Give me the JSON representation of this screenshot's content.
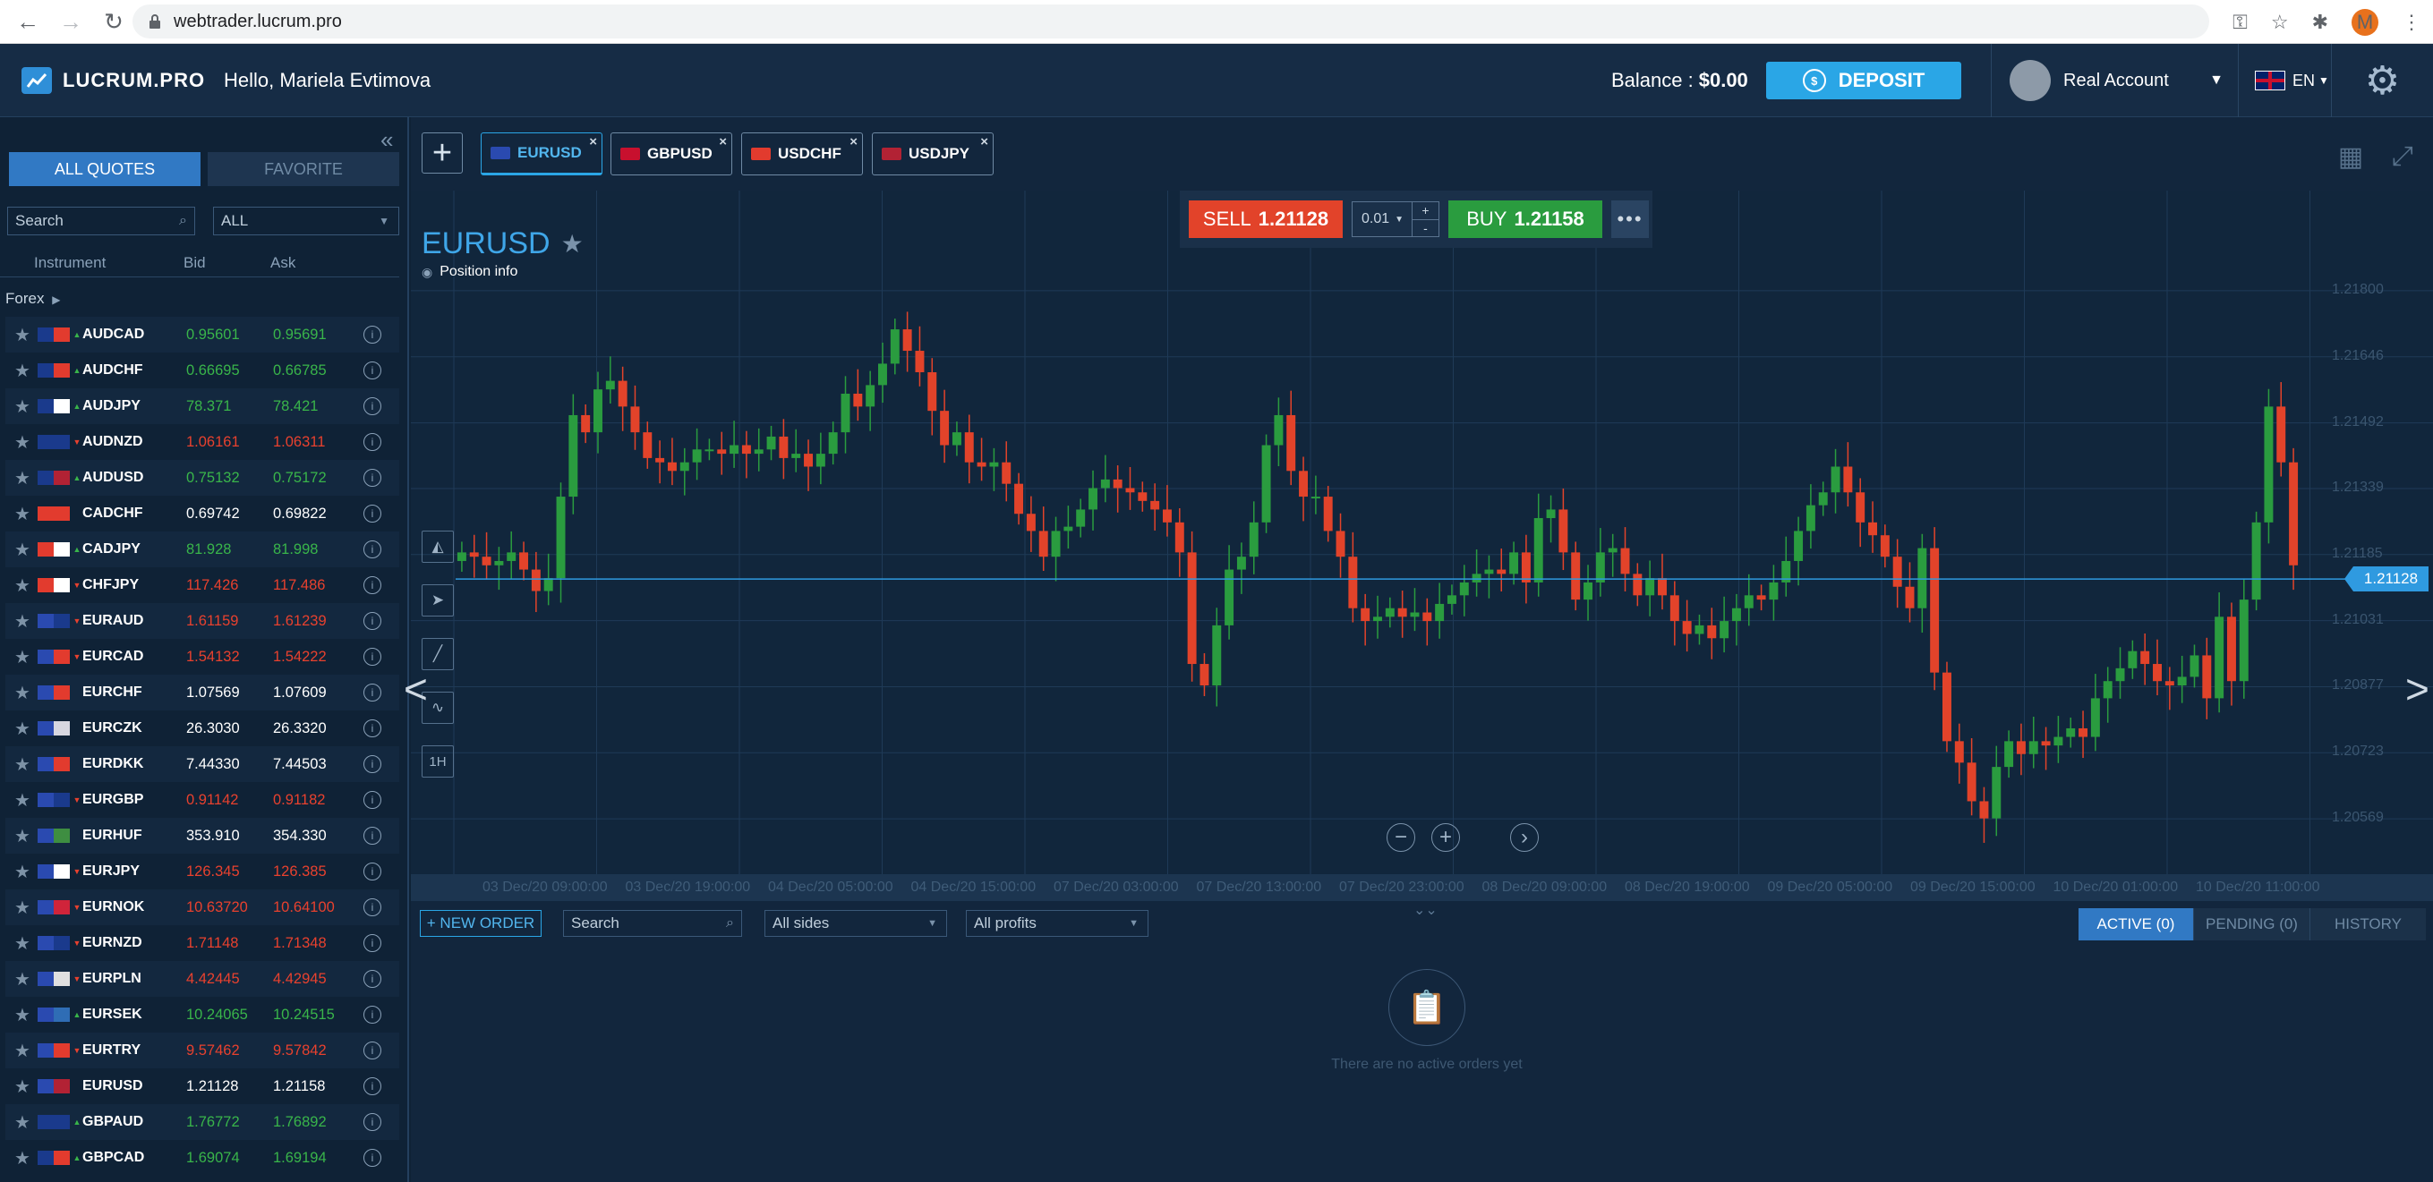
{
  "browser": {
    "url": "webtrader.lucrum.pro",
    "profile_initial": "M"
  },
  "header": {
    "logo": "LUCRUM.PRO",
    "greeting": "Hello, Mariela Evtimova",
    "balance_label": "Balance :",
    "balance_value": "$0.00",
    "deposit_label": "DEPOSIT",
    "account_label": "Real Account",
    "language": "EN"
  },
  "sidebar": {
    "tab_all": "ALL QUOTES",
    "tab_favorite": "FAVORITE",
    "search_placeholder": "Search",
    "filter_value": "ALL",
    "col_instrument": "Instrument",
    "col_bid": "Bid",
    "col_ask": "Ask",
    "group": "Forex",
    "quotes": [
      {
        "sym": "AUDCAD",
        "bid": "0.95601",
        "ask": "0.95691",
        "dir": "up",
        "color": "green",
        "f1": "#1a3a8c",
        "f2": "#e23b2e"
      },
      {
        "sym": "AUDCHF",
        "bid": "0.66695",
        "ask": "0.66785",
        "dir": "up",
        "color": "green",
        "f1": "#1a3a8c",
        "f2": "#e23b2e"
      },
      {
        "sym": "AUDJPY",
        "bid": "78.371",
        "ask": "78.421",
        "dir": "up",
        "color": "green",
        "f1": "#1a3a8c",
        "f2": "#ffffff"
      },
      {
        "sym": "AUDNZD",
        "bid": "1.06161",
        "ask": "1.06311",
        "dir": "down",
        "color": "red",
        "f1": "#1a3a8c",
        "f2": "#1a3a8c"
      },
      {
        "sym": "AUDUSD",
        "bid": "0.75132",
        "ask": "0.75172",
        "dir": "up",
        "color": "green",
        "f1": "#1a3a8c",
        "f2": "#b22234"
      },
      {
        "sym": "CADCHF",
        "bid": "0.69742",
        "ask": "0.69822",
        "dir": "none",
        "color": "white",
        "f1": "#e23b2e",
        "f2": "#e23b2e"
      },
      {
        "sym": "CADJPY",
        "bid": "81.928",
        "ask": "81.998",
        "dir": "up",
        "color": "green",
        "f1": "#e23b2e",
        "f2": "#ffffff"
      },
      {
        "sym": "CHFJPY",
        "bid": "117.426",
        "ask": "117.486",
        "dir": "down",
        "color": "red",
        "f1": "#e23b2e",
        "f2": "#ffffff"
      },
      {
        "sym": "EURAUD",
        "bid": "1.61159",
        "ask": "1.61239",
        "dir": "down",
        "color": "red",
        "f1": "#2a4ab0",
        "f2": "#1a3a8c"
      },
      {
        "sym": "EURCAD",
        "bid": "1.54132",
        "ask": "1.54222",
        "dir": "down",
        "color": "red",
        "f1": "#2a4ab0",
        "f2": "#e23b2e"
      },
      {
        "sym": "EURCHF",
        "bid": "1.07569",
        "ask": "1.07609",
        "dir": "none",
        "color": "white",
        "f1": "#2a4ab0",
        "f2": "#e23b2e"
      },
      {
        "sym": "EURCZK",
        "bid": "26.3030",
        "ask": "26.3320",
        "dir": "none",
        "color": "white",
        "f1": "#2a4ab0",
        "f2": "#d7d7e0"
      },
      {
        "sym": "EURDKK",
        "bid": "7.44330",
        "ask": "7.44503",
        "dir": "none",
        "color": "white",
        "f1": "#2a4ab0",
        "f2": "#e23b2e"
      },
      {
        "sym": "EURGBP",
        "bid": "0.91142",
        "ask": "0.91182",
        "dir": "down",
        "color": "red",
        "f1": "#2a4ab0",
        "f2": "#1a3a8c"
      },
      {
        "sym": "EURHUF",
        "bid": "353.910",
        "ask": "354.330",
        "dir": "none",
        "color": "white",
        "f1": "#2a4ab0",
        "f2": "#3e8e41"
      },
      {
        "sym": "EURJPY",
        "bid": "126.345",
        "ask": "126.385",
        "dir": "down",
        "color": "red",
        "f1": "#2a4ab0",
        "f2": "#ffffff"
      },
      {
        "sym": "EURNOK",
        "bid": "10.63720",
        "ask": "10.64100",
        "dir": "down",
        "color": "red",
        "f1": "#2a4ab0",
        "f2": "#d0243a"
      },
      {
        "sym": "EURNZD",
        "bid": "1.71148",
        "ask": "1.71348",
        "dir": "down",
        "color": "red",
        "f1": "#2a4ab0",
        "f2": "#1a3a8c"
      },
      {
        "sym": "EURPLN",
        "bid": "4.42445",
        "ask": "4.42945",
        "dir": "down",
        "color": "red",
        "f1": "#2a4ab0",
        "f2": "#e0e0e0"
      },
      {
        "sym": "EURSEK",
        "bid": "10.24065",
        "ask": "10.24515",
        "dir": "up",
        "color": "green",
        "f1": "#2a4ab0",
        "f2": "#2f6db5"
      },
      {
        "sym": "EURTRY",
        "bid": "9.57462",
        "ask": "9.57842",
        "dir": "down",
        "color": "red",
        "f1": "#2a4ab0",
        "f2": "#e23b2e"
      },
      {
        "sym": "EURUSD",
        "bid": "1.21128",
        "ask": "1.21158",
        "dir": "none",
        "color": "white",
        "f1": "#2a4ab0",
        "f2": "#b22234"
      },
      {
        "sym": "GBPAUD",
        "bid": "1.76772",
        "ask": "1.76892",
        "dir": "up",
        "color": "green",
        "f1": "#1a3a8c",
        "f2": "#1a3a8c"
      },
      {
        "sym": "GBPCAD",
        "bid": "1.69074",
        "ask": "1.69194",
        "dir": "up",
        "color": "green",
        "f1": "#1a3a8c",
        "f2": "#e23b2e"
      }
    ]
  },
  "tabs": [
    {
      "label": "EURUSD",
      "active": true,
      "flag": "#2a4ab0"
    },
    {
      "label": "GBPUSD",
      "active": false,
      "flag": "#c8102e"
    },
    {
      "label": "USDCHF",
      "active": false,
      "flag": "#e23b2e"
    },
    {
      "label": "USDJPY",
      "active": false,
      "flag": "#b22234"
    }
  ],
  "trade": {
    "symbol": "EURUSD",
    "position_info": "Position info",
    "sell_label": "SELL",
    "sell_price": "1.21128",
    "lot": "0.01",
    "buy_label": "BUY",
    "buy_price": "1.21158",
    "current_price_label": "1.21128"
  },
  "colors": {
    "up": "#2a9c3f",
    "down": "#e2432a",
    "price_line": "#2f9ae0"
  },
  "chart_data": {
    "type": "candlestick",
    "title": "EURUSD",
    "current_price": 1.21128,
    "ylim": [
      1.2049,
      1.2195
    ],
    "y_ticks": [
      "1.21800",
      "1.21646",
      "1.21492",
      "1.21339",
      "1.21185",
      "1.21031",
      "1.20877",
      "1.20723",
      "1.20569"
    ],
    "x_ticks": [
      "03 Dec/20 09:00:00",
      "03 Dec/20 19:00:00",
      "04 Dec/20 05:00:00",
      "04 Dec/20 15:00:00",
      "07 Dec/20 03:00:00",
      "07 Dec/20 13:00:00",
      "07 Dec/20 23:00:00",
      "08 Dec/20 09:00:00",
      "08 Dec/20 19:00:00",
      "09 Dec/20 05:00:00",
      "09 Dec/20 15:00:00",
      "10 Dec/20 01:00:00",
      "10 Dec/20 11:00:00"
    ],
    "closes": [
      1.2119,
      1.2118,
      1.2116,
      1.2117,
      1.2119,
      1.2115,
      1.211,
      1.2113,
      1.2132,
      1.2151,
      1.2147,
      1.2157,
      1.2159,
      1.2153,
      1.2147,
      1.2141,
      1.214,
      1.2138,
      1.214,
      1.2143,
      1.2143,
      1.2142,
      1.2144,
      1.2142,
      1.2143,
      1.2146,
      1.2141,
      1.2142,
      1.2139,
      1.2142,
      1.2147,
      1.2156,
      1.2153,
      1.2158,
      1.2163,
      1.2171,
      1.2166,
      1.2161,
      1.2152,
      1.2144,
      1.2147,
      1.214,
      1.2139,
      1.214,
      1.2135,
      1.2128,
      1.2124,
      1.2118,
      1.2124,
      1.2125,
      1.2129,
      1.2134,
      1.2136,
      1.2134,
      1.2133,
      1.2131,
      1.2129,
      1.2126,
      1.2119,
      1.2093,
      1.2088,
      1.2102,
      1.2115,
      1.2118,
      1.2126,
      1.2144,
      1.2151,
      1.2138,
      1.2132,
      1.2132,
      1.2124,
      1.2118,
      1.2106,
      1.2103,
      1.2104,
      1.2106,
      1.2104,
      1.2105,
      1.2103,
      1.2107,
      1.2109,
      1.2112,
      1.2114,
      1.2115,
      1.2114,
      1.2119,
      1.2112,
      1.2127,
      1.2129,
      1.2119,
      1.2108,
      1.2112,
      1.2119,
      1.212,
      1.2114,
      1.2109,
      1.2113,
      1.2109,
      1.2103,
      1.21,
      1.2102,
      1.2099,
      1.2103,
      1.2106,
      1.2109,
      1.2108,
      1.2112,
      1.2117,
      1.2124,
      1.213,
      1.2133,
      1.2139,
      1.2133,
      1.2126,
      1.2123,
      1.2118,
      1.2111,
      1.2106,
      1.212,
      1.2091,
      1.2075,
      1.207,
      1.2061,
      1.2057,
      1.2069,
      1.2075,
      1.2072,
      1.2075,
      1.2074,
      1.2076,
      1.2078,
      1.2076,
      1.2085,
      1.2089,
      1.2092,
      1.2096,
      1.2093,
      1.2089,
      1.2088,
      1.209,
      1.2095,
      1.2085,
      1.2104,
      1.2089,
      1.2108,
      1.2126,
      1.2153,
      1.214,
      1.2116
    ]
  }
}
